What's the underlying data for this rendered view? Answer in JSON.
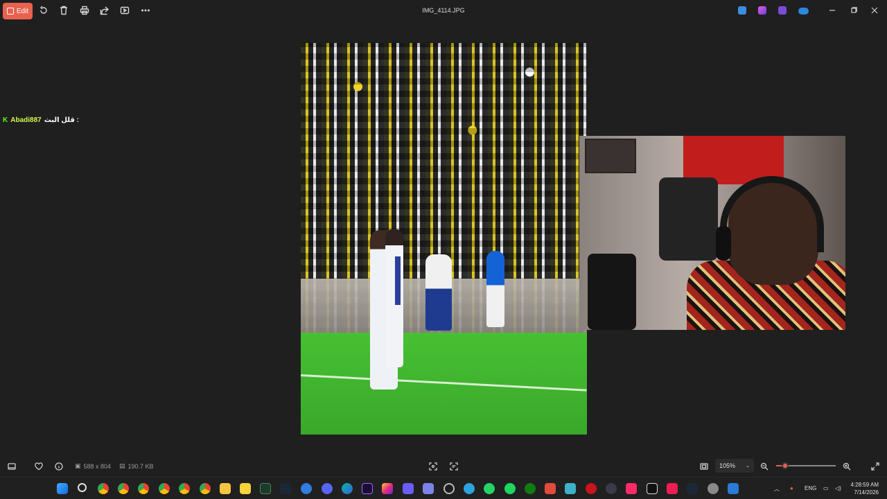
{
  "toolbar": {
    "edit_label": "Edit",
    "title": "IMG_4114.JPG",
    "icons": [
      "rotate-icon",
      "delete-icon",
      "print-icon",
      "share-icon",
      "slideshow-icon",
      "more-icon"
    ],
    "colors": {
      "accent": "#e8624f",
      "background": "#1f1f1f"
    }
  },
  "chat": {
    "username": "Abadi887",
    "message": "قلل البث :"
  },
  "status": {
    "dimensions": "588 x 804",
    "file_size": "190.7 KB",
    "zoom": "105%",
    "zoom_level": 0.15
  },
  "taskbar": {
    "language": "ENG",
    "time": "4:28:59 AM",
    "date": "7/14/2026"
  }
}
